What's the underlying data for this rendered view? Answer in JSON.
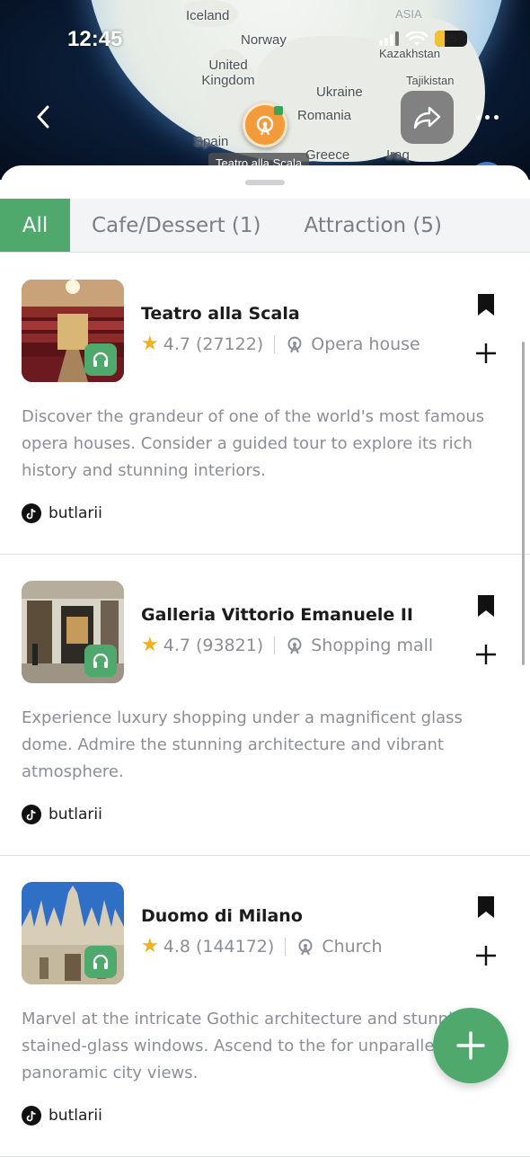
{
  "status_bar": {
    "time": "12:45",
    "battery": "25"
  },
  "map": {
    "labels": [
      "Iceland",
      "Norway",
      "United Kingdom",
      "Ukraine",
      "Romania",
      "Spain",
      "Greece",
      "Iraq",
      "Kazakhstan",
      "Tajikistan",
      "ASIA"
    ],
    "selected_place": "Teatro alla Scala",
    "colors": {
      "ocean": "#7fb4db",
      "land": "#e9ece6",
      "pin": "#f39a3a"
    }
  },
  "tabs": [
    {
      "label": "All",
      "active": true
    },
    {
      "label": "Cafe/Dessert (1)",
      "active": false
    },
    {
      "label": "Attraction (5)",
      "active": false
    }
  ],
  "places": [
    {
      "name": "Teatro alla Scala",
      "rating": "4.7",
      "reviews": "(27122)",
      "category": "Opera house",
      "description": "Discover the grandeur of one of the world's most famous opera houses. Consider a guided tour to explore its rich history and stunning interiors.",
      "author": "butlarii"
    },
    {
      "name": "Galleria Vittorio Emanuele II",
      "rating": "4.7",
      "reviews": "(93821)",
      "category": "Shopping mall",
      "description": "Experience luxury shopping under a magnificent glass dome. Admire the stunning architecture and vibrant atmosphere.",
      "author": "butlarii"
    },
    {
      "name": "Duomo di Milano",
      "rating": "4.8",
      "reviews": "(144172)",
      "category": "Church",
      "description": "Marvel at the intricate Gothic architecture and stunning stained-glass windows. Ascend to the for unparalleled panoramic city views.",
      "author": "butlarii"
    }
  ],
  "icons": {
    "back": "chevron-left-icon",
    "share": "share-arrow-icon",
    "more": "more-dots-icon",
    "bookmark": "bookmark-icon",
    "add": "plus-icon",
    "audio": "headphones-icon",
    "rating": "star-icon",
    "category": "ferris-wheel-icon",
    "author": "tiktok-icon"
  },
  "theme": {
    "accent": "#4fa96c",
    "star": "#f2b01e",
    "muted_text": "#8b8f95"
  }
}
